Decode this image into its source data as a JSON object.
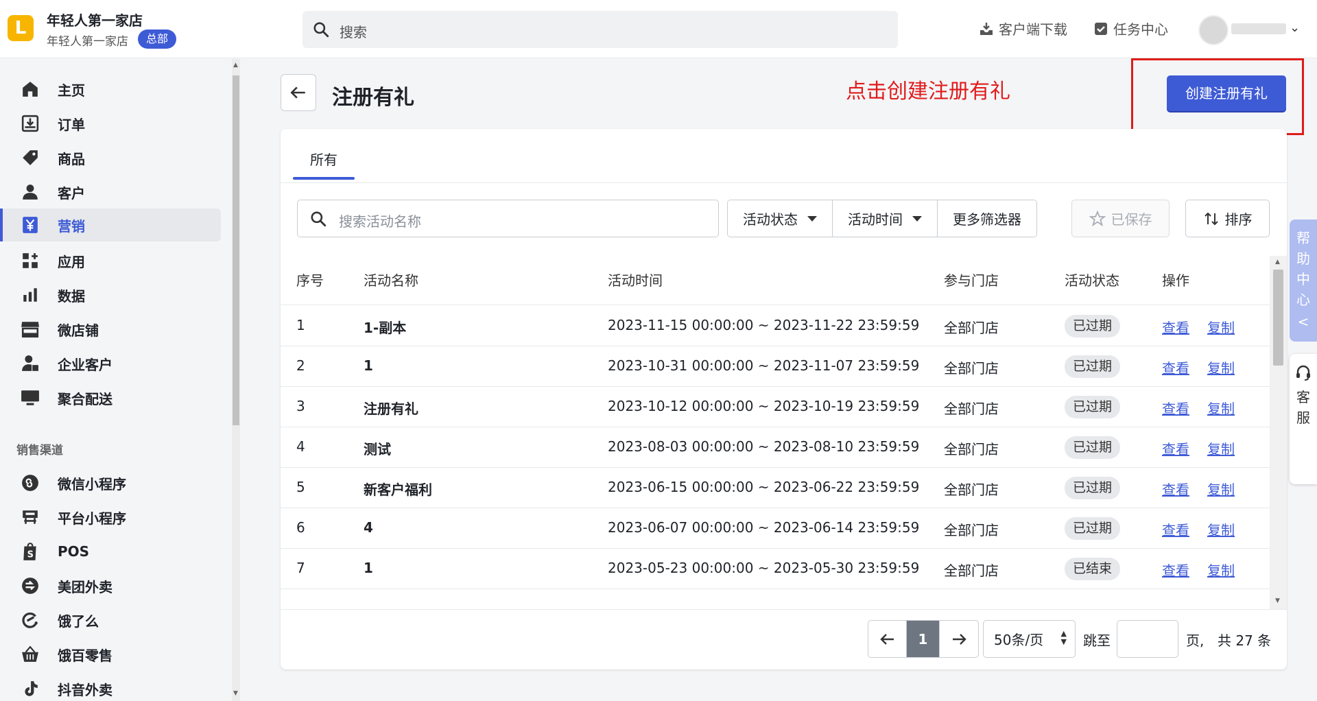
{
  "header": {
    "logo_letter": "L",
    "store_name": "年轻人第一家店",
    "store_sub": "年轻人第一家店",
    "store_badge": "总部",
    "search_placeholder": "搜索",
    "download_label": "客户端下载",
    "task_label": "任务中心",
    "colors": {
      "accent": "#3e5bd6",
      "logo": "#f7b500"
    }
  },
  "sidebar": {
    "items": [
      {
        "label": "主页",
        "icon": "home-icon"
      },
      {
        "label": "订单",
        "icon": "order-download-icon"
      },
      {
        "label": "商品",
        "icon": "tag-icon"
      },
      {
        "label": "客户",
        "icon": "person-icon"
      },
      {
        "label": "营销",
        "icon": "yen-icon",
        "active": true
      },
      {
        "label": "应用",
        "icon": "apps-icon"
      },
      {
        "label": "数据",
        "icon": "bar-chart-icon"
      },
      {
        "label": "微店铺",
        "icon": "storefront-icon"
      },
      {
        "label": "企业客户",
        "icon": "enterprise-user-icon"
      },
      {
        "label": "聚合配送",
        "icon": "monitor-icon"
      }
    ],
    "section_title": "销售渠道",
    "channels": [
      {
        "label": "微信小程序",
        "icon": "mini-program-icon"
      },
      {
        "label": "平台小程序",
        "icon": "platform-icon"
      },
      {
        "label": "POS",
        "icon": "pos-bag-icon"
      },
      {
        "label": "美团外卖",
        "icon": "meituan-icon"
      },
      {
        "label": "饿了么",
        "icon": "eleme-icon"
      },
      {
        "label": "饿百零售",
        "icon": "basket-icon"
      },
      {
        "label": "抖音外卖",
        "icon": "tiktok-icon"
      }
    ]
  },
  "page": {
    "title": "注册有礼",
    "annotation": "点击创建注册有礼",
    "create_button": "创建注册有礼",
    "annotation_color": "#e01b1b"
  },
  "tabs": [
    {
      "label": "所有",
      "active": true
    }
  ],
  "filters": {
    "search_placeholder": "搜索活动名称",
    "status": "活动状态",
    "time": "活动时间",
    "more": "更多筛选器",
    "saved": "已保存",
    "sort": "排序"
  },
  "table": {
    "columns": [
      "序号",
      "活动名称",
      "活动时间",
      "参与门店",
      "活动状态",
      "操作"
    ],
    "rows": [
      {
        "no": "1",
        "name": "1-副本",
        "time": "2023-11-15 00:00:00 ~ 2023-11-22 23:59:59",
        "store": "全部门店",
        "status": "已过期",
        "view": "查看",
        "copy": "复制"
      },
      {
        "no": "2",
        "name": "1",
        "time": "2023-10-31 00:00:00 ~ 2023-11-07 23:59:59",
        "store": "全部门店",
        "status": "已过期",
        "view": "查看",
        "copy": "复制"
      },
      {
        "no": "3",
        "name": "注册有礼",
        "time": "2023-10-12 00:00:00 ~ 2023-10-19 23:59:59",
        "store": "全部门店",
        "status": "已过期",
        "view": "查看",
        "copy": "复制"
      },
      {
        "no": "4",
        "name": "测试",
        "time": "2023-08-03 00:00:00 ~ 2023-08-10 23:59:59",
        "store": "全部门店",
        "status": "已过期",
        "view": "查看",
        "copy": "复制"
      },
      {
        "no": "5",
        "name": "新客户福利",
        "time": "2023-06-15 00:00:00 ~ 2023-06-22 23:59:59",
        "store": "全部门店",
        "status": "已过期",
        "view": "查看",
        "copy": "复制"
      },
      {
        "no": "6",
        "name": "4",
        "time": "2023-06-07 00:00:00 ~ 2023-06-14 23:59:59",
        "store": "全部门店",
        "status": "已过期",
        "view": "查看",
        "copy": "复制"
      },
      {
        "no": "7",
        "name": "1",
        "time": "2023-05-23 00:00:00 ~ 2023-05-30 23:59:59",
        "store": "全部门店",
        "status": "已结束",
        "view": "查看",
        "copy": "复制"
      }
    ]
  },
  "pagination": {
    "current_page": "1",
    "per_page": "50条/页",
    "jump_label": "跳至",
    "page_suffix": "页,",
    "total": "共 27 条"
  },
  "floating": {
    "help": "帮助中心",
    "help_arrow": "<",
    "service": "客服"
  }
}
